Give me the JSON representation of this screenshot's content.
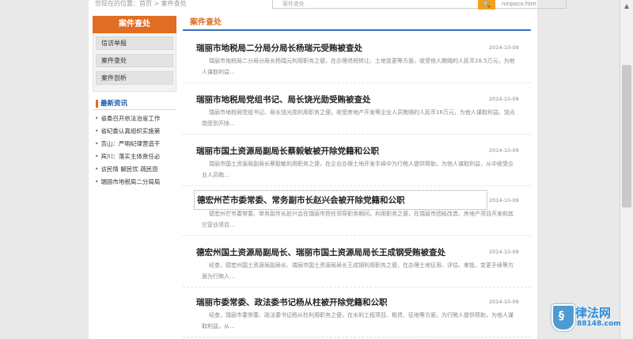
{
  "top": {
    "crumb": "您现在的位置：首页 > 案件查处",
    "search_placeholder": "案件查处",
    "search_button": "🔍",
    "link": "ninpocx.htm"
  },
  "sidebar": {
    "header": "案件查处",
    "menu": [
      {
        "label": "信访举报"
      },
      {
        "label": "案件查处"
      },
      {
        "label": "案件剖析"
      }
    ],
    "news_title": "最新资讯",
    "news": [
      {
        "text": "省委召开依法治省工作"
      },
      {
        "text": "省纪委认真组织实施第"
      },
      {
        "text": "贡山：严明纪律营造干"
      },
      {
        "text": "宾川：落实主体责任必"
      },
      {
        "text": "访民情 解民忧 疏民怨"
      },
      {
        "text": "瑞丽市地税局二分局局"
      }
    ]
  },
  "main": {
    "title": "案件查处",
    "articles": [
      {
        "title": "瑞丽市地税局二分局分局长杨瑞元受贿被查处",
        "date": "2014-10-09",
        "summary": "瑞丽市地税局二分局分局长杨瑞元利用职务之便，在办理退税转让、土地变更等方面，收受他人贿赂的人民币28.5万元，为他人谋取利益…"
      },
      {
        "title": "瑞丽市地税局党组书记、局长饶光勋受贿被查处",
        "date": "2014-10-09",
        "summary": "瑞丽市地税局党组书记、局长饶光勋利用职务之便，收受房地产开发等企业人员贿赂的人民币16万元，为他人谋取利益。饶光勋受到开除…"
      },
      {
        "title": "瑞丽市国土资源局副局长蔡毅敏被开除党籍和公职",
        "date": "2014-10-09",
        "summary": "瑞丽市国土资源局副局长蔡毅敏利用职务之便，在企业办理土地开发手续中为行贿人提供帮助，为他人谋取利益，从中收受企业人员贿…"
      },
      {
        "title": "德宏州芒市委常委、常务副市长赵兴会被开除党籍和公职",
        "date": "2014-10-09",
        "summary": "德宏州芒市委常委、常务副市长赵兴会在瑞丽市担任领导职务期间，利用职务之便，在瑞丽市团结改造、房地产项目开发和其它营业项目…"
      },
      {
        "title": "德宏州国土资源局副局长、瑞丽市国土资源局局长王成钢受贿被查处",
        "date": "2014-10-09",
        "summary": "经查，德宏州国土资源局副局长、瑞丽市国土资源局局长王成钢利用职务之便，在办理土地征用、评估、审批、变更手续等方面为行贿人…"
      },
      {
        "title": "瑞丽市委常委、政法委书记杨从柱被开除党籍和公职",
        "date": "2014-10-09",
        "summary": "经查，瑞丽市委常委、政法委书记杨从柱利用职务之便，在水利工程项目、租赁、征地等方面，为行贿人提供帮助，为他人谋取利益，从…"
      }
    ]
  },
  "watermark": {
    "text": "律法网",
    "sub": "88148.com"
  }
}
